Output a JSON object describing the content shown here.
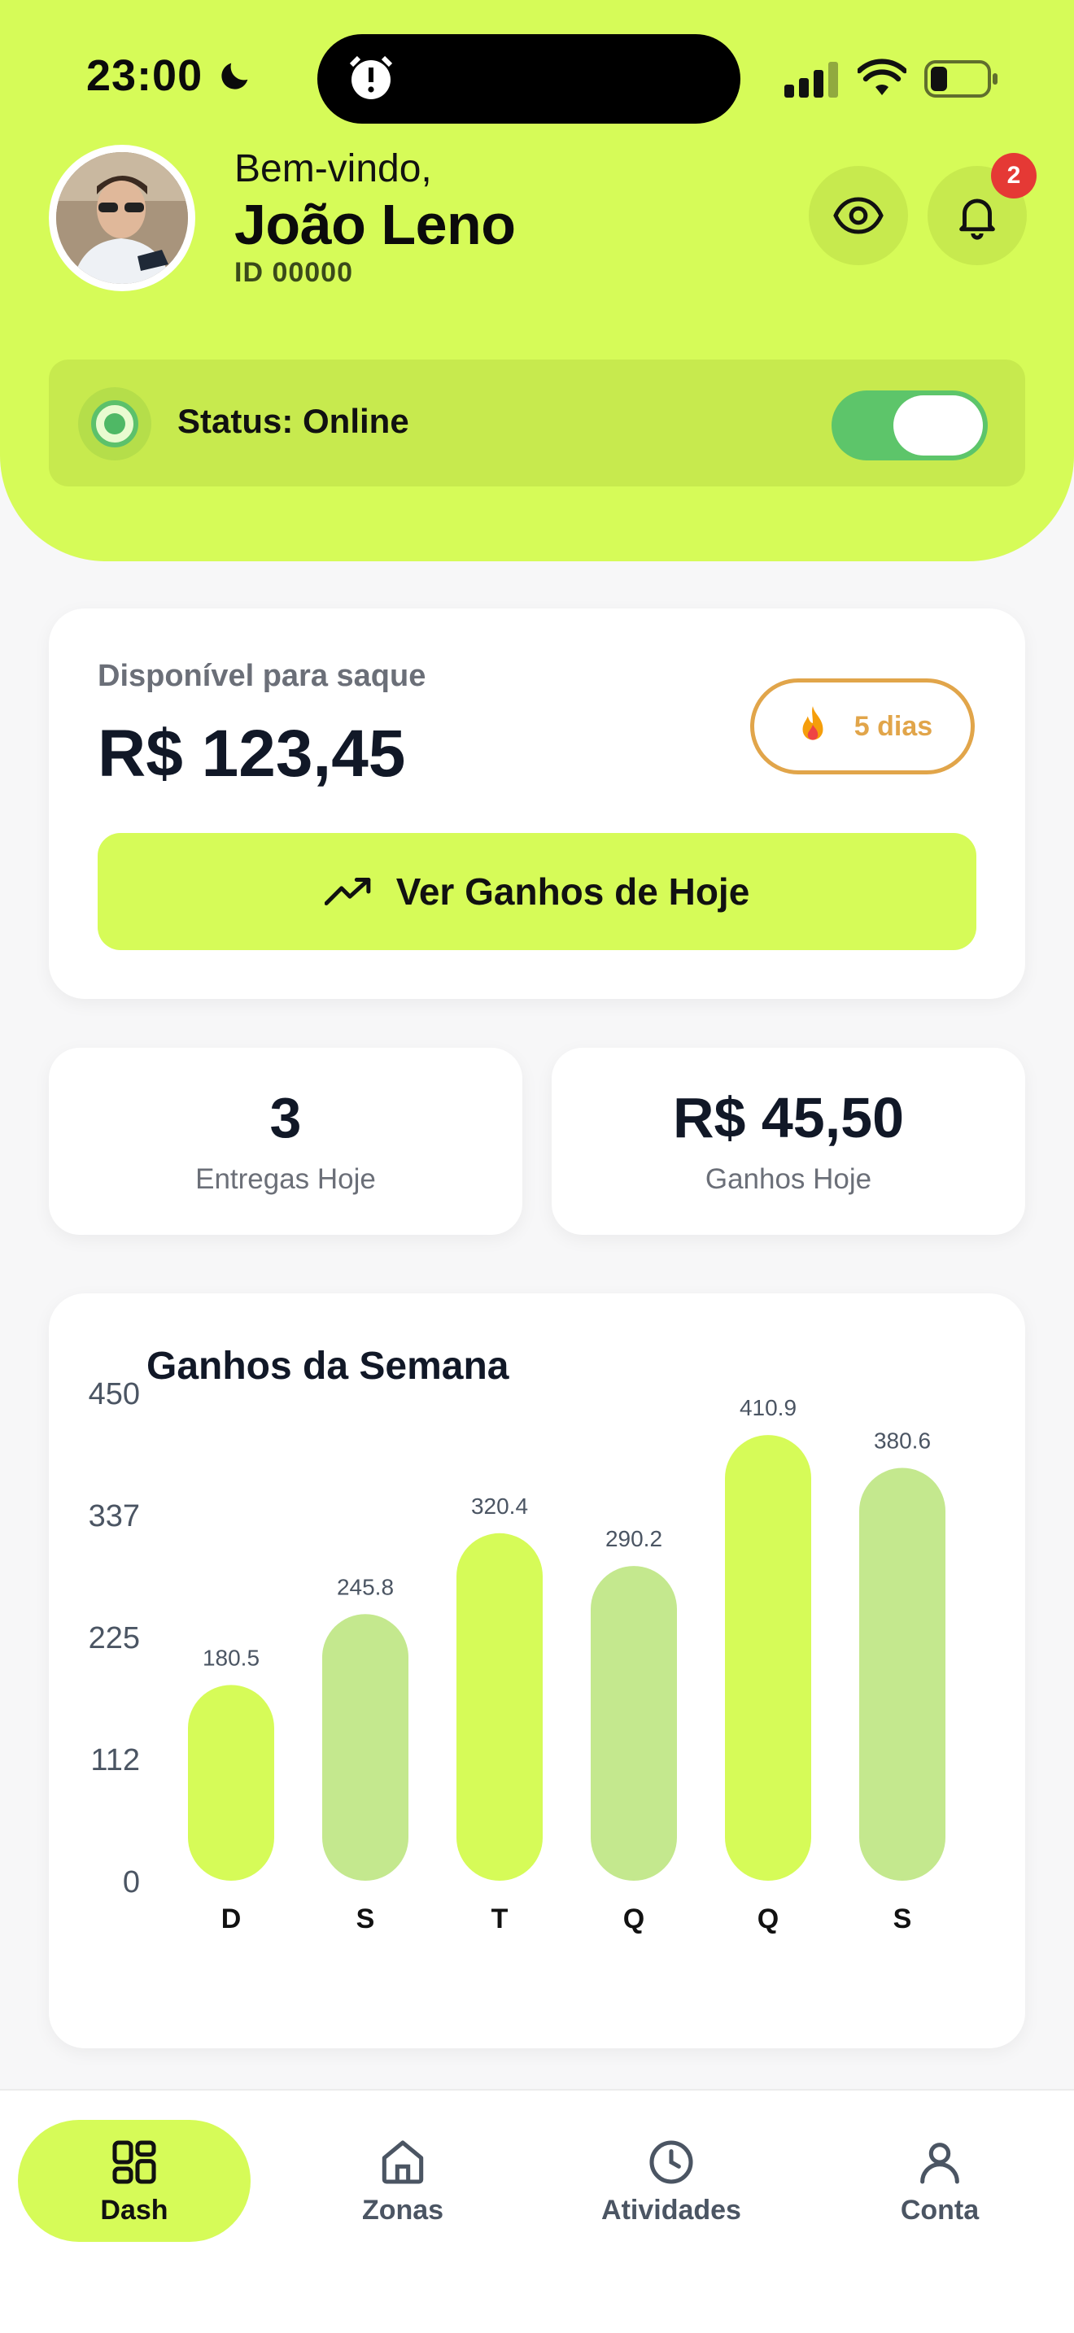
{
  "status_bar": {
    "time": "23:00"
  },
  "header": {
    "greeting": "Bem-vindo,",
    "user_name": "João Leno",
    "user_id": "ID 00000",
    "notification_count": "2"
  },
  "status": {
    "label": "Status: Online",
    "online": true
  },
  "balance": {
    "label": "Disponível para saque",
    "value": "R$ 123,45",
    "streak_label": "5 dias",
    "cta_label": "Ver Ganhos de Hoje"
  },
  "stats": {
    "deliveries_value": "3",
    "deliveries_label": "Entregas Hoje",
    "earnings_value": "R$ 45,50",
    "earnings_label": "Ganhos Hoje"
  },
  "chart_data": {
    "type": "bar",
    "title": "Ganhos da Semana",
    "categories": [
      "D",
      "S",
      "T",
      "Q",
      "Q",
      "S"
    ],
    "values": [
      180.5,
      245.8,
      320.4,
      290.2,
      410.9,
      380.6
    ],
    "value_labels": [
      "180.5",
      "245.8",
      "320.4",
      "290.2",
      "410.9",
      "380.6"
    ],
    "y_ticks": [
      "450",
      "337",
      "225",
      "112",
      "0"
    ],
    "ylim": [
      0,
      450
    ],
    "bar_colors": [
      "#d6fb58",
      "#c4e88e",
      "#d6fb58",
      "#c4e88e",
      "#d6fb58",
      "#c4e88e"
    ]
  },
  "nav": {
    "items": [
      {
        "label": "Dash",
        "icon": "grid-icon",
        "active": true
      },
      {
        "label": "Zonas",
        "icon": "home-icon",
        "active": false
      },
      {
        "label": "Atividades",
        "icon": "clock-icon",
        "active": false
      },
      {
        "label": "Conta",
        "icon": "user-icon",
        "active": false
      }
    ]
  },
  "colors": {
    "accent": "#d6fb58",
    "online_green": "#5dc56a",
    "streak_orange": "#e1a54a",
    "badge_red": "#e53935"
  }
}
